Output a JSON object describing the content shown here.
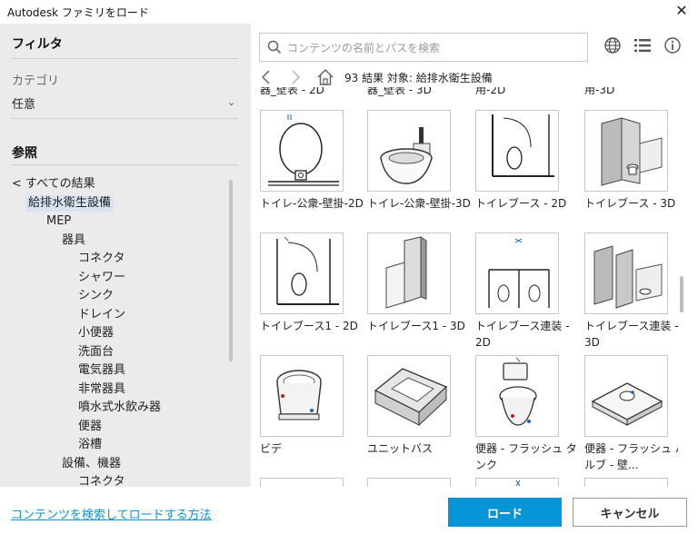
{
  "window": {
    "title": "Autodesk ファミリをロード",
    "close_label": "✕"
  },
  "sidebar": {
    "filter_title": "フィルタ",
    "category_label": "カテゴリ",
    "category_value": "任意",
    "reference_title": "参照",
    "tree": [
      {
        "label": "< すべての結果",
        "level": 0
      },
      {
        "label": "給排水衛生設備",
        "level": 1,
        "selected": true
      },
      {
        "label": "MEP",
        "level": 2
      },
      {
        "label": "器具",
        "level": 3
      },
      {
        "label": "コネクタ",
        "level": 4
      },
      {
        "label": "シャワー",
        "level": 4
      },
      {
        "label": "シンク",
        "level": 4
      },
      {
        "label": "ドレイン",
        "level": 4
      },
      {
        "label": "小便器",
        "level": 4
      },
      {
        "label": "洗面台",
        "level": 4
      },
      {
        "label": "電気器具",
        "level": 4
      },
      {
        "label": "非常器具",
        "level": 4
      },
      {
        "label": "噴水式水飲み器",
        "level": 4
      },
      {
        "label": "便器",
        "level": 4
      },
      {
        "label": "浴槽",
        "level": 4
      },
      {
        "label": "設備、機器",
        "level": 3
      },
      {
        "label": "コネクタ",
        "level": 4
      }
    ]
  },
  "search": {
    "placeholder": "コンテンツの名前とパスを検索",
    "value": ""
  },
  "toolbar": {
    "icons": [
      "globe-icon",
      "list-view-icon",
      "info-icon"
    ]
  },
  "breadcrumb": {
    "text": "93 結果  対象: 給排水衛生設備"
  },
  "clipped_labels": [
    "器_壁表 - 2D",
    "器_壁表 - 3D",
    "用-2D",
    "用-3D"
  ],
  "items": [
    {
      "label": "トイレ-公衆-壁掛-2D",
      "thumb": "toilet-wall-2d"
    },
    {
      "label": "トイレ-公衆-壁掛-3D",
      "thumb": "toilet-wall-3d"
    },
    {
      "label": "トイレブース - 2D",
      "thumb": "booth-2d"
    },
    {
      "label": "トイレブース - 3D",
      "thumb": "booth-3d"
    },
    {
      "label": "トイレブース1 - 2D",
      "thumb": "booth1-2d"
    },
    {
      "label": "トイレブース1 - 3D",
      "thumb": "booth1-3d"
    },
    {
      "label": "トイレブース連装 - 2D",
      "thumb": "booth-multi-2d"
    },
    {
      "label": "トイレブース連装 - 3D",
      "thumb": "booth-multi-3d"
    },
    {
      "label": "ビデ",
      "thumb": "bidet"
    },
    {
      "label": "ユニットバス",
      "thumb": "unit-bath"
    },
    {
      "label": "便器 - フラッシュ タンク",
      "thumb": "toilet-tank"
    },
    {
      "label": "便器 - フラッシュ バルブ - 壁...",
      "thumb": "toilet-valve"
    }
  ],
  "footer": {
    "help_link": "コンテンツを検索してロードする方法",
    "load_label": "ロード",
    "cancel_label": "キャンセル"
  },
  "colors": {
    "accent": "#0696d7",
    "sidebar_bg": "#ebebeb",
    "selected_bg": "#d8e4f2"
  }
}
